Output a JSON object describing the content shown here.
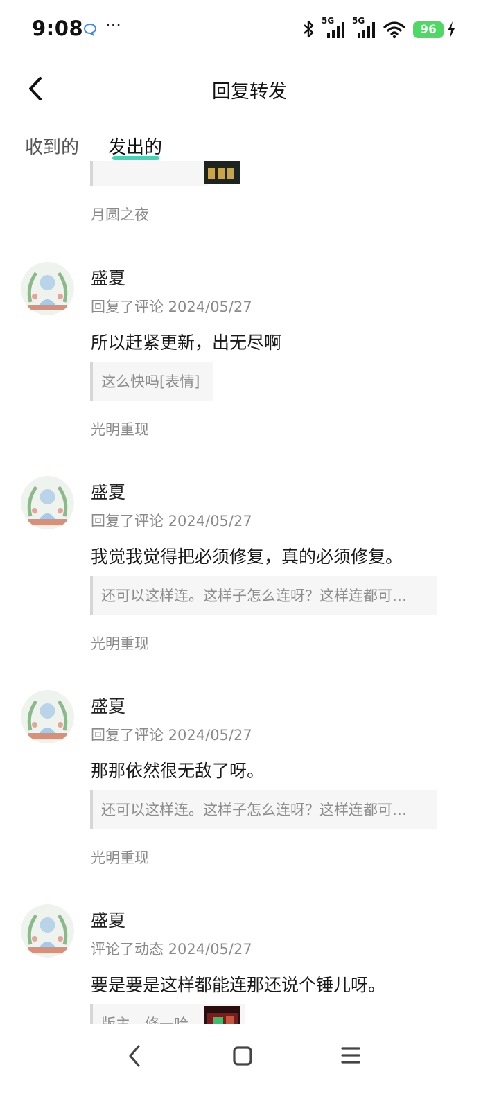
{
  "status_bar": {
    "time": "9:08",
    "more": "···",
    "battery": "96",
    "net1": "5G",
    "net2": "5G"
  },
  "header": {
    "title": "回复转发"
  },
  "tabs": [
    {
      "label": "收到的",
      "active": false
    },
    {
      "label": "发出的",
      "active": true
    }
  ],
  "items": [
    {
      "source": "月圆之夜"
    },
    {
      "name": "盛夏",
      "meta": "回复了评论 2024/05/27",
      "content": "所以赶紧更新，出无尽啊",
      "quote": "这么快吗[表情]",
      "source": "光明重现"
    },
    {
      "name": "盛夏",
      "meta": "回复了评论 2024/05/27",
      "content": "我觉我觉得把必须修复，真的必须修复。",
      "quote": "还可以这样连。这样子怎么连呀？这样连都可…",
      "source": "光明重现"
    },
    {
      "name": "盛夏",
      "meta": "回复了评论 2024/05/27",
      "content": "那那依然很无敌了呀。",
      "quote": "还可以这样连。这样子怎么连呀？这样连都可…",
      "source": "光明重现"
    },
    {
      "name": "盛夏",
      "meta": "评论了动态 2024/05/27",
      "content": "要是要是这样都能连那还说个锤儿呀。",
      "quote": "版主，修一哈"
    }
  ],
  "colors": {
    "accent": "#3fd6b6",
    "battery": "#4cd964",
    "muted_text": "#8a8a8a"
  }
}
